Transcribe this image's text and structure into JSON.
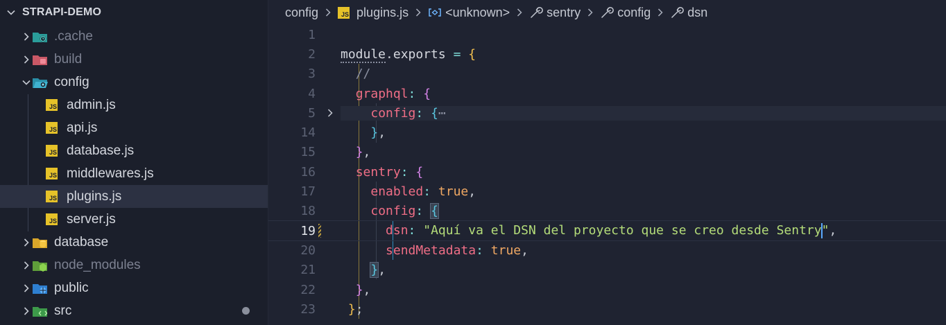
{
  "explorer": {
    "title": "STRAPI-DEMO",
    "items": [
      {
        "label": ".cache",
        "dim": true
      },
      {
        "label": "build",
        "dim": true
      },
      {
        "label": "config"
      },
      {
        "label": "admin.js"
      },
      {
        "label": "api.js"
      },
      {
        "label": "database.js"
      },
      {
        "label": "middlewares.js"
      },
      {
        "label": "plugins.js"
      },
      {
        "label": "server.js"
      },
      {
        "label": "database"
      },
      {
        "label": "node_modules",
        "dim": true
      },
      {
        "label": "public"
      },
      {
        "label": "src"
      }
    ],
    "js_badge": "JS"
  },
  "breadcrumb": {
    "items": [
      "config",
      "plugins.js",
      "<unknown>",
      "sentry",
      "config",
      "dsn"
    ]
  },
  "code": {
    "line_numbers": [
      "1",
      "2",
      "3",
      "4",
      "5",
      "14",
      "15",
      "16",
      "17",
      "18",
      "19",
      "20",
      "21",
      "22",
      "23"
    ],
    "tokens": {
      "module": "module",
      "dot": ".",
      "exports": "exports",
      "eq": " = ",
      "lbrace": "{",
      "comment": "//",
      "graphql": "graphql",
      "colon": ": ",
      "config": "config",
      "ellipsis": "⋯",
      "rbrace_comma": "},",
      "sentry": "sentry",
      "enabled": "enabled",
      "true": "true",
      "comma": ",",
      "dsn": "dsn",
      "dsn_value_before_cursor": "\"Aquí va el DSN del proyecto que se creo desde Sentry",
      "quote": "\"",
      "sendMetadata": "sendMetadata",
      "rbrace": "}",
      "semicolon": ";"
    }
  },
  "colors": {
    "property": "#ef6e86",
    "keyword_obj": "#7fdcd8",
    "string": "#b4dc79",
    "boolean": "#f0a863",
    "bracket": "#f3c04f"
  }
}
